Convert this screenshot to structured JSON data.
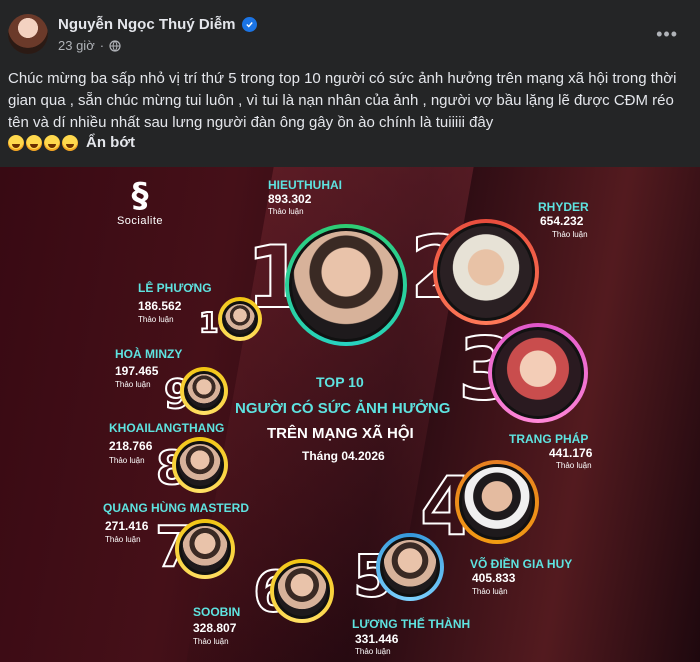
{
  "post": {
    "author": "Nguyễn Ngọc Thuý Diễm",
    "time": "23 giờ",
    "more_icon": "more-horizontal-icon",
    "text": "Chúc mừng ba sấp nhỏ vị trí thứ 5 trong top 10 người có sức ảnh hưởng trên mạng xã hội trong thời gian qua , sẵn chúc mừng tui luôn , vì tui là nạn nhân của ảnh , người vợ bầu lặng lẽ được CĐM réo tên và dí nhiều nhất sau lưng người đàn ông gây ồn ào chính là tuiiiii đây",
    "emoji_count": 4,
    "hide_label": "Ẩn bớt"
  },
  "infographic": {
    "brand": "Socialite",
    "title_top": "TOP 10",
    "title_main": "NGƯỜI CÓ SỨC ẢNH HƯỞNG",
    "title_sub": "TRÊN MẠNG XÃ HỘI",
    "title_date": "Tháng 04.2026",
    "discuss_label": "Thảo luận",
    "ranks": [
      {
        "rank": "1",
        "name": "HIEUTHUHAI",
        "count": "893.302",
        "ring": "#2ecc71"
      },
      {
        "rank": "2",
        "name": "RHYDER",
        "count": "654.232",
        "ring": "#e74c3c"
      },
      {
        "rank": "3",
        "name": "TRANG PHÁP",
        "count": "441.176",
        "ring": "#e056c9"
      },
      {
        "rank": "4",
        "name": "VÕ ĐIỀN GIA HUY",
        "count": "405.833",
        "ring": "#e67e22"
      },
      {
        "rank": "5",
        "name": "LƯƠNG THẾ THÀNH",
        "count": "331.446",
        "ring": "#3498db"
      },
      {
        "rank": "6",
        "name": "SOOBIN",
        "count": "328.807",
        "ring": "#f1c40f"
      },
      {
        "rank": "7",
        "name": "QUANG HÙNG MASTERD",
        "count": "271.416",
        "ring": "#f1c40f"
      },
      {
        "rank": "8",
        "name": "KHOAILANGTHANG",
        "count": "218.766",
        "ring": "#f1c40f"
      },
      {
        "rank": "9",
        "name": "HOÀ MINZY",
        "count": "197.465",
        "ring": "#f1c40f"
      },
      {
        "rank": "10",
        "name": "LÊ PHƯƠNG",
        "count": "186.562",
        "ring": "#f1c40f"
      }
    ]
  }
}
